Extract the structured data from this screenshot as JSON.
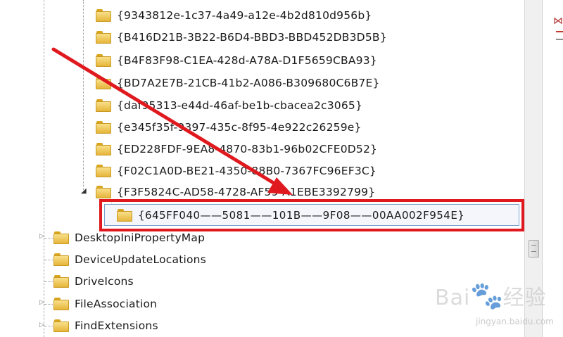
{
  "tree": {
    "guid_items": [
      "{9343812e-1c37-4a49-a12e-4b2d810d956b}",
      "{B416D21B-3B22-B6D4-BBD3-BBD452DB3D5B}",
      "{B4F83F98-C1EA-428d-A78A-D1F5659CBA93}",
      "{BD7A2E7B-21CB-41b2-A086-B309680C6B7E}",
      "{daf95313-e44d-46af-be1b-cbacea2c3065}",
      "{e345f35f-9397-435c-8f95-4e922c26259e}",
      "{ED228FDF-9EA8-4870-83b1-96b02CFE0D52}",
      "{F02C1A0D-BE21-4350-88B0-7367FC96EF3C}",
      "{F3F5824C-AD58-4728-AF59-A1EBE3392799}"
    ],
    "selected_child": "{645FF040——5081——101B——9F08——00AA002F954E}",
    "top_items": [
      "DesktopIniPropertyMap",
      "DeviceUpdateLocations",
      "DriveIcons",
      "FileAssociation",
      "FindExtensions"
    ]
  },
  "watermark": {
    "logo": "Bai",
    "logo_suffix": "经验",
    "site": "jingyan.baidu.com"
  },
  "colors": {
    "highlight": "#e0191f",
    "arrow": "#e0191f",
    "folder": "#f2c94c"
  }
}
